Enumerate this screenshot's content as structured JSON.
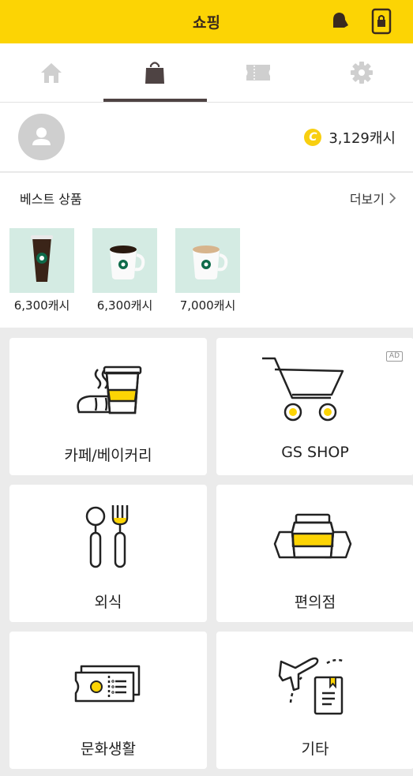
{
  "header": {
    "title": "쇼핑",
    "accent_color": "#fcd404"
  },
  "tabs": [
    {
      "icon": "home-icon",
      "active": false
    },
    {
      "icon": "shopping-bag-icon",
      "active": true
    },
    {
      "icon": "ticket-icon",
      "active": false
    },
    {
      "icon": "gear-icon",
      "active": false
    }
  ],
  "profile": {
    "coin_symbol": "C",
    "cash": "3,129캐시"
  },
  "best": {
    "title": "베스트 상품",
    "more_label": "더보기",
    "products": [
      {
        "price": "6,300캐시"
      },
      {
        "price": "6,300캐시"
      },
      {
        "price": "7,000캐시"
      }
    ]
  },
  "categories": [
    {
      "label": "카페/베이커리"
    },
    {
      "label": "GS SHOP",
      "badge": "AD"
    },
    {
      "label": "외식"
    },
    {
      "label": "편의점"
    },
    {
      "label": "문화생활"
    },
    {
      "label": "기타"
    }
  ]
}
